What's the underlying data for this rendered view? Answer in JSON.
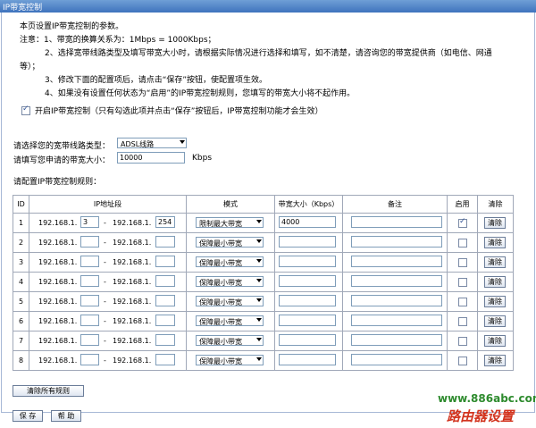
{
  "title": "IP带宽控制",
  "notes": {
    "intro": "本页设置IP带宽控制的参数。",
    "n1": "注意：1、带宽的换算关系为：1Mbps = 1000Kbps；",
    "n2a": "2、选择宽带线路类型及填写带宽大小时，请根据实际情况进行选择和填写，如不清楚，请咨询您的带宽提供商（如电信、网通",
    "n2b": "等）；",
    "n3": "3、修改下面的配置项后，请点击“保存”按钮，使配置项生效。",
    "n4": "4、如果没有设置任何状态为“启用”的IP带宽控制规则，您填写的带宽大小将不起作用。"
  },
  "enable": {
    "checked": true,
    "label": "开启IP带宽控制（只有勾选此项并点击“保存”按钮后，IP带宽控制功能才会生效）"
  },
  "line_type": {
    "label": "请选择您的宽带线路类型：",
    "value": "ADSL线路"
  },
  "bandwidth": {
    "label": "请填写您申请的带宽大小：",
    "value": "10000",
    "unit": "Kbps"
  },
  "rules_label": "请配置IP带宽控制规则：",
  "columns": {
    "id": "ID",
    "ip": "IP地址段",
    "mode": "模式",
    "bw": "带宽大小（Kbps）",
    "note": "备注",
    "enabled": "启用",
    "clear": "清除"
  },
  "ip_prefix": "192.168.1.",
  "ip_dash": "-",
  "rows": [
    {
      "id": "1",
      "start": "3",
      "end": "254",
      "mode": "限制最大带宽",
      "bw": "4000",
      "note": "",
      "enabled": true,
      "clear": "清除"
    },
    {
      "id": "2",
      "start": "",
      "end": "",
      "mode": "保障最小带宽",
      "bw": "",
      "note": "",
      "enabled": false,
      "clear": "清除"
    },
    {
      "id": "3",
      "start": "",
      "end": "",
      "mode": "保障最小带宽",
      "bw": "",
      "note": "",
      "enabled": false,
      "clear": "清除"
    },
    {
      "id": "4",
      "start": "",
      "end": "",
      "mode": "保障最小带宽",
      "bw": "",
      "note": "",
      "enabled": false,
      "clear": "清除"
    },
    {
      "id": "5",
      "start": "",
      "end": "",
      "mode": "保障最小带宽",
      "bw": "",
      "note": "",
      "enabled": false,
      "clear": "清除"
    },
    {
      "id": "6",
      "start": "",
      "end": "",
      "mode": "保障最小带宽",
      "bw": "",
      "note": "",
      "enabled": false,
      "clear": "清除"
    },
    {
      "id": "7",
      "start": "",
      "end": "",
      "mode": "保障最小带宽",
      "bw": "",
      "note": "",
      "enabled": false,
      "clear": "清除"
    },
    {
      "id": "8",
      "start": "",
      "end": "",
      "mode": "保障最小带宽",
      "bw": "",
      "note": "",
      "enabled": false,
      "clear": "清除"
    }
  ],
  "clear_all": "清除所有规则",
  "save": "保 存",
  "help": "帮 助",
  "watermark": {
    "url": "www.886abc.com",
    "text": "路由器设置"
  },
  "colors": {
    "title_bg": "#4a7fc6",
    "watermark_url": "#2e8b2e",
    "watermark_text": "#d2331e"
  }
}
